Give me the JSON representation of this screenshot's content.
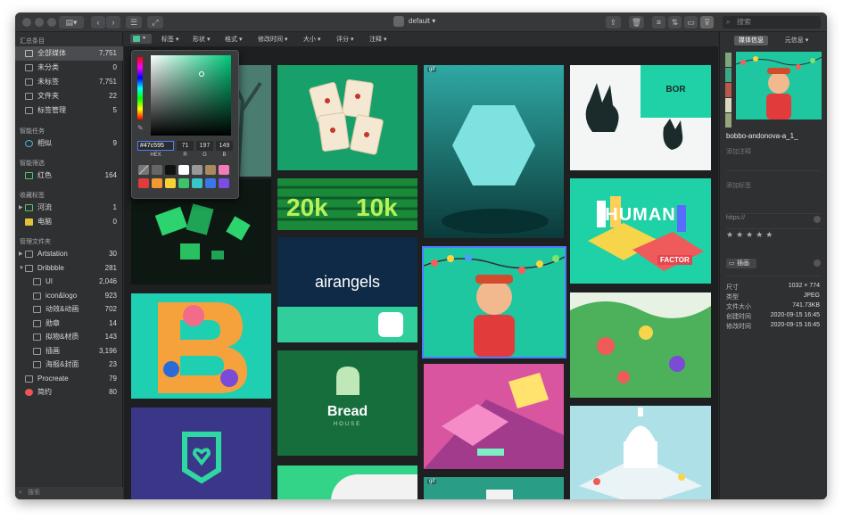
{
  "toolbar": {
    "library_name": "default",
    "search_placeholder": "搜索"
  },
  "filters": [
    "标签",
    "形状",
    "格式",
    "修改时间",
    "大小",
    "评分",
    "注释"
  ],
  "sidebar": {
    "section_library": "汇总条目",
    "library_items": [
      {
        "label": "全部媒体",
        "count": "7,751"
      },
      {
        "label": "未分类",
        "count": "0"
      },
      {
        "label": "未标签",
        "count": "7,751"
      },
      {
        "label": "文件夹",
        "count": "22"
      },
      {
        "label": "标签管理",
        "count": "5"
      }
    ],
    "section_smart": "智能任务",
    "smart_items": [
      {
        "label": "相似",
        "count": "9"
      }
    ],
    "section_filter": "智能筛选",
    "filter_items": [
      {
        "label": "红色",
        "count": "164"
      }
    ],
    "section_tags": "收藏标签",
    "tag_items": [
      {
        "label": "河流",
        "count": "1"
      },
      {
        "label": "电脑",
        "count": "0"
      }
    ],
    "section_folders": "管理文件夹",
    "folder_items": [
      {
        "label": "Artstation",
        "count": "30"
      },
      {
        "label": "Dribbble",
        "count": "281"
      },
      {
        "label": "UI",
        "count": "2,046"
      },
      {
        "label": "icon&logo",
        "count": "923"
      },
      {
        "label": "动效&动画",
        "count": "702"
      },
      {
        "label": "勋章",
        "count": "14"
      },
      {
        "label": "拟物&材质",
        "count": "143"
      },
      {
        "label": "插画",
        "count": "3,196"
      },
      {
        "label": "海报&封面",
        "count": "23"
      },
      {
        "label": "Procreate",
        "count": "79"
      },
      {
        "label": "简约",
        "count": "80"
      }
    ],
    "footer_search": "搜索"
  },
  "color_picker": {
    "hex": "#47c595",
    "r": "71",
    "g": "197",
    "b": "149",
    "hex_label": "HEX",
    "r_label": "R",
    "g_label": "G",
    "b_label": "B"
  },
  "tiles": {
    "airangels": "airangels",
    "bread": "Bread",
    "bread_sub": "HOUSE",
    "gif1": "gif",
    "gif2": "gif",
    "bor": "BOR",
    "human": "HUMAN",
    "factor": "FACTOR"
  },
  "inspector": {
    "tab_media": "媒体信息",
    "tab_meta": "元信息",
    "filename": "bobbo-andonova-a_1_",
    "note_placeholder": "添加注释",
    "tag_placeholder": "添加标签",
    "url_placeholder": "https://",
    "folder_chip": "插画",
    "meta": [
      {
        "k": "尺寸",
        "v": "1032 × 774"
      },
      {
        "k": "类型",
        "v": "JPEG"
      },
      {
        "k": "文件大小",
        "v": "741.73KB"
      },
      {
        "k": "创建时间",
        "v": "2020-09-15 16:45"
      },
      {
        "k": "修改时间",
        "v": "2020-09-15 16:45"
      }
    ],
    "rating": 0
  },
  "colors": {
    "accent": "#47c595",
    "selection": "#4f7cff"
  }
}
